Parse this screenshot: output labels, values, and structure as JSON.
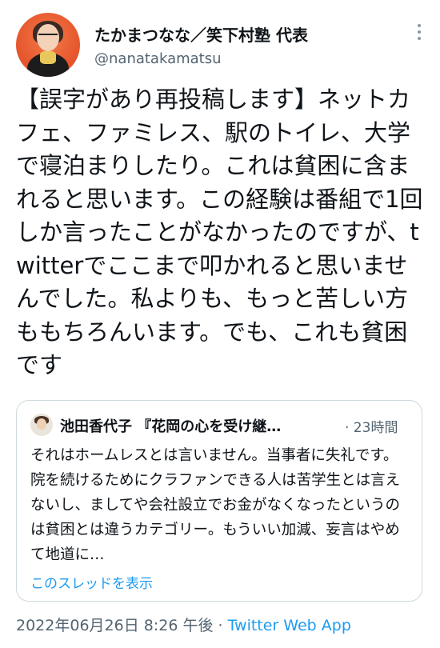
{
  "author": {
    "display_name": "たかまつなな／笑下村塾 代表",
    "handle": "@nanatakamatsu"
  },
  "tweet": {
    "text": "【誤字があり再投稿します】ネットカフェ、ファミレス、駅のトイレ、大学で寝泊まりしたり。これは貧困に含まれると思います。この経験は番組で1回しか言ったことがなかったのですが、twitterでここまで叩かれると思いませんでした。私よりも、もっと苦しい方ももちろんいます。でも、これも貧困です"
  },
  "quoted_tweet": {
    "display_name": "池田香代子 『花岡の心を受け継…",
    "time": "· 23時間",
    "text": "それはホームレスとは言いません。当事者に失礼です。院を続けるためにクラファンできる人は苦学生とは言えないし、ましてや会社設立でお金がなくなったというのは貧困とは違うカテゴリー。もういい加減、妄言はやめて地道に…",
    "show_thread_label": "このスレッドを表示"
  },
  "meta": {
    "datetime": "2022年06月26日 8:26 午後",
    "separator": " · ",
    "source": "Twitter Web App"
  },
  "colors": {
    "link": "#1d9bf0",
    "secondary_text": "#536471",
    "border": "#cfd9de"
  },
  "icons": {
    "more": "more-options-icon"
  }
}
